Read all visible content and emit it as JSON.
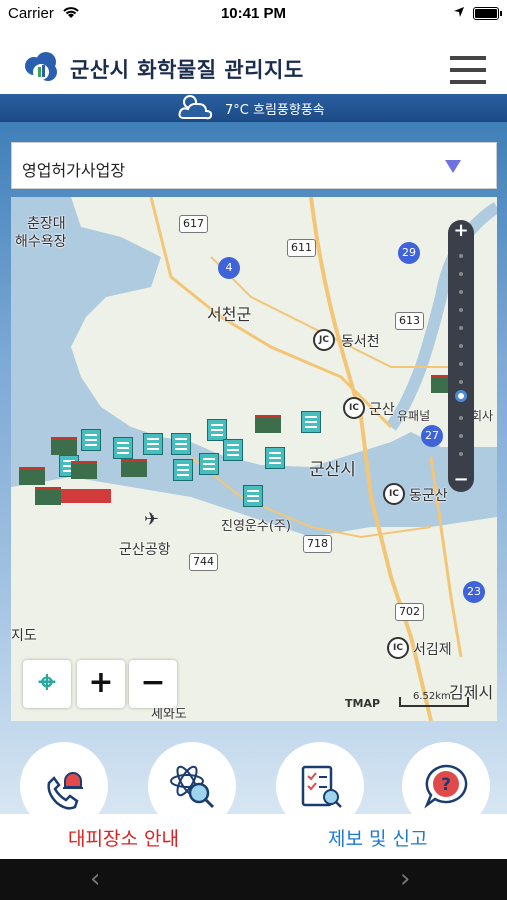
{
  "status_bar": {
    "carrier": "Carrier",
    "time": "10:41 PM"
  },
  "header": {
    "title": "군산시 화학물질 관리지도"
  },
  "weather": {
    "text": "7°C 흐림풍향풍속"
  },
  "dropdown": {
    "selected": "영업허가사업장"
  },
  "map": {
    "labels": {
      "beach": "춘장대",
      "beach2": "해수욕장",
      "seocheon": "서천군",
      "dongseocheon": "동서천",
      "gunsan_ic": "군산",
      "gunsan_city": "군산시",
      "donggunsan": "동군산",
      "airport": "군산공항",
      "jinyoung": "진영운수(주)",
      "seogimje": "서김제",
      "gimje": "김제시",
      "jido": "지도",
      "sewado": "세와도",
      "yupanel": "유패널",
      "hoesa": "회사"
    },
    "roads": {
      "r617": "617",
      "r611": "611",
      "r4": "4",
      "r29": "29",
      "r613": "613",
      "r27": "27",
      "r744": "744",
      "r718": "718",
      "r702": "702",
      "r23": "23"
    },
    "junctions": {
      "jc": "JC",
      "ic1": "IC",
      "ic2": "IC",
      "ic3": "IC"
    },
    "scale_label": "6.52km",
    "provider": "TMAP",
    "zoom_level_fraction": 0.7
  },
  "controls": {
    "locate": "⌖",
    "zoom_in": "+",
    "zoom_out": "−",
    "rail_plus": "+",
    "rail_minus": "−"
  },
  "actions": [
    "emergency-call",
    "chemical-search",
    "checklist",
    "help"
  ],
  "bottom": {
    "left_label": "대피장소 안내",
    "right_label": "제보 및 신고"
  },
  "nav": {
    "back": "‹",
    "forward": "›"
  },
  "colors": {
    "accent_red": "#e02020",
    "accent_blue": "#1f7ad4",
    "header_blue": "#1c4a86"
  }
}
